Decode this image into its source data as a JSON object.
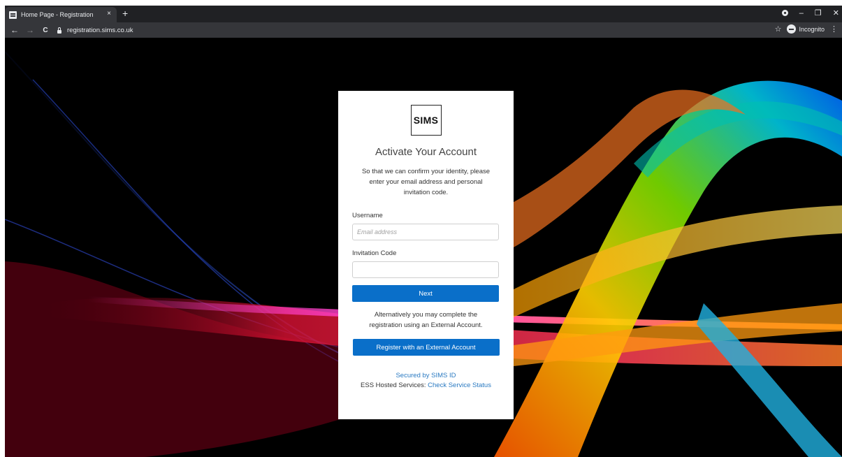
{
  "browser": {
    "tab_title": "Home Page - Registration",
    "tab_close": "×",
    "new_tab": "+",
    "url": "registration.sims.co.uk",
    "incognito_label": "Incognito",
    "back_glyph": "←",
    "forward_glyph": "→",
    "reload_glyph": "C",
    "star_glyph": "☆",
    "menu_glyph": "⋮",
    "minimize_glyph": "–",
    "restore_glyph": "❐",
    "close_glyph": "✕"
  },
  "card": {
    "logo_text": "SIMS",
    "heading": "Activate Your Account",
    "intro": "So that we can confirm your identity, please enter your email address and personal invitation code.",
    "username_label": "Username",
    "username_placeholder": "Email address",
    "username_value": "",
    "invitation_label": "Invitation Code",
    "invitation_value": "",
    "next_button": "Next",
    "alternative_text": "Alternatively you may complete the registration using an External Account.",
    "external_button": "Register with an External Account",
    "secured_link": "Secured by SIMS ID",
    "ess_prefix": "ESS Hosted Services: ",
    "status_link": "Check Service Status"
  },
  "colors": {
    "primary_button": "#0a6fc9",
    "link": "#2a7ac2",
    "browser_frame": "#202124",
    "toolbar": "#35363a"
  },
  "icons": [
    "browser-tab-favicon-icon",
    "lock-icon",
    "star-icon",
    "incognito-icon",
    "extension-icon",
    "kebab-menu-icon"
  ]
}
